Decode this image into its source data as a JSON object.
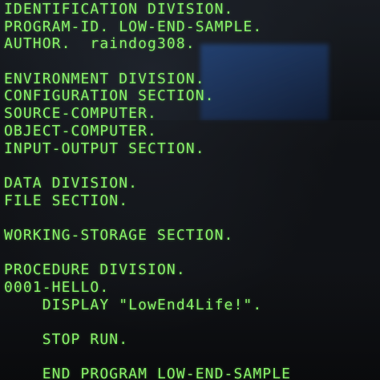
{
  "terminal": {
    "text_color": "#8af36a",
    "background_color": "#0c0e11",
    "lines": [
      "IDENTIFICATION DIVISION.",
      "PROGRAM-ID. LOW-END-SAMPLE.",
      "AUTHOR.  raindog308.",
      "",
      "ENVIRONMENT DIVISION.",
      "CONFIGURATION SECTION.",
      "SOURCE-COMPUTER.",
      "OBJECT-COMPUTER.",
      "INPUT-OUTPUT SECTION.",
      "",
      "DATA DIVISION.",
      "FILE SECTION.",
      "",
      "WORKING-STORAGE SECTION.",
      "",
      "PROCEDURE DIVISION.",
      "0001-HELLO.",
      "    DISPLAY \"LowEnd4Life!\".",
      "",
      "    STOP RUN.",
      "",
      "    END PROGRAM LOW-END-SAMPLE"
    ]
  }
}
